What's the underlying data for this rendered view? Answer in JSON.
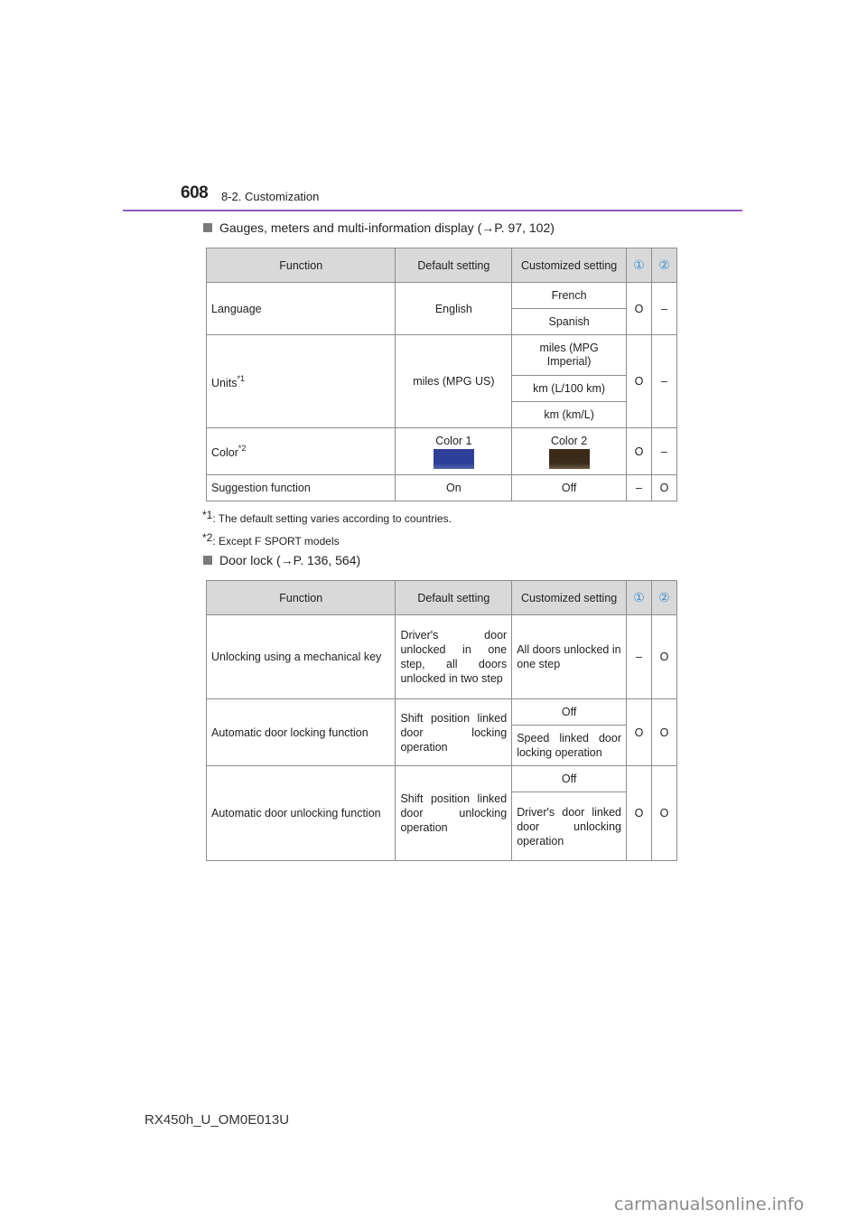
{
  "header": {
    "page_number": "608",
    "section": "8-2. Customization"
  },
  "section1": {
    "heading": "Gauges, meters and multi-information display (→P. 97, 102)",
    "columns": [
      "Function",
      "Default setting",
      "Customized setting",
      "①",
      "②"
    ],
    "rows": [
      {
        "function": "Language",
        "default": "English",
        "customized": [
          "French",
          "Spanish"
        ],
        "col1": "O",
        "col2": "–"
      },
      {
        "function": "Units",
        "function_note": "*1",
        "default": "miles (MPG US)",
        "customized": [
          "miles (MPG Imperial)",
          "km (L/100 km)",
          "km (km/L)"
        ],
        "col1": "O",
        "col2": "–"
      },
      {
        "function": "Color",
        "function_note": "*2",
        "default": "Color 1",
        "default_swatch": "#2e3f9a",
        "customized": [
          "Color 2"
        ],
        "customized_swatch": "#3d2a18",
        "col1": "O",
        "col2": "–"
      },
      {
        "function": "Suggestion function",
        "default": "On",
        "customized": [
          "Off"
        ],
        "col1": "–",
        "col2": "O"
      }
    ],
    "footnotes": [
      {
        "mark": "*1",
        "text": ": The default setting varies according to countries."
      },
      {
        "mark": "*2",
        "text": ": Except F SPORT models"
      }
    ]
  },
  "section2": {
    "heading": "Door lock (→P. 136, 564)",
    "columns": [
      "Function",
      "Default setting",
      "Customized setting",
      "①",
      "②"
    ],
    "rows": [
      {
        "function": "Unlocking using a mechanical key",
        "default": "Driver's door unlocked in one step, all doors unlocked in two step",
        "customized": [
          "All doors unlocked in one step"
        ],
        "col1": "–",
        "col2": "O"
      },
      {
        "function": "Automatic door locking function",
        "default": "Shift position linked door locking operation",
        "customized": [
          "Off",
          "Speed linked door locking operation"
        ],
        "col1": "O",
        "col2": "O"
      },
      {
        "function": "Automatic door unlocking function",
        "default": "Shift position linked door unlocking operation",
        "customized": [
          "Off",
          "Driver's door linked door unlocking operation"
        ],
        "col1": "O",
        "col2": "O"
      }
    ]
  },
  "footer": {
    "doc_code": "RX450h_U_OM0E013U",
    "watermark": "carmanualsonline.info"
  }
}
